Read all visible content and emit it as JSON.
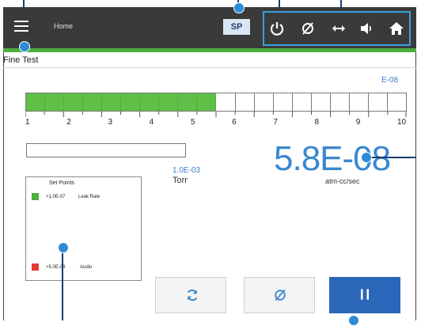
{
  "header": {
    "home_label": "Home",
    "sp_label": "SP",
    "icons": [
      "menu-icon",
      "power-icon",
      "null-icon",
      "arrows-icon",
      "speaker-icon",
      "home-icon"
    ]
  },
  "main": {
    "title": "Fine Test",
    "exponent_label": "E-08",
    "bar": {
      "segments": 20,
      "filled": 10
    },
    "scale": [
      "1",
      "2",
      "3",
      "4",
      "5",
      "6",
      "7",
      "8",
      "9",
      "10"
    ],
    "secondary": {
      "value": "1.0E-03",
      "unit": "Torr"
    },
    "leak_rate": {
      "value": "5.8E-08",
      "unit": "atm-cc/sec"
    },
    "set_points": {
      "title": "Set Points",
      "items": [
        {
          "color": "#4caf3e",
          "value": ">1.0E-07",
          "label": "Leak Rate"
        },
        {
          "color": "#e53935",
          "value": ">5.0E-08",
          "label": "Audio"
        }
      ]
    }
  },
  "controls": {
    "buttons": [
      "refresh-button",
      "null-button",
      "pause-button"
    ]
  },
  "colors": {
    "header_bg": "#3a3a3a",
    "accent_green": "#4caf3e",
    "value_blue": "#3a87d0",
    "pause_blue": "#2a67b8",
    "callout_blue": "#2f8bd6"
  }
}
